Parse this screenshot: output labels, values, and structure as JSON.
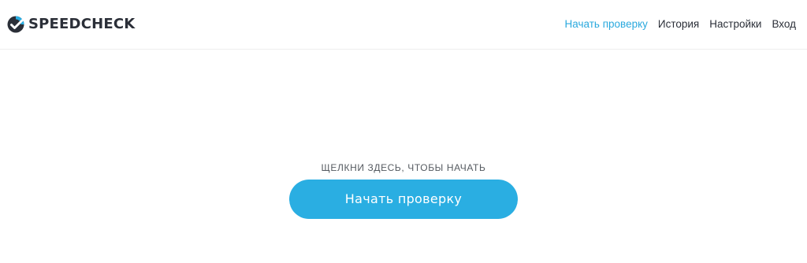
{
  "header": {
    "logo_text": "SPEEDCHECK",
    "nav": [
      {
        "label": "Начать проверку",
        "active": true
      },
      {
        "label": "История",
        "active": false
      },
      {
        "label": "Настройки",
        "active": false
      },
      {
        "label": "Вход",
        "active": false
      }
    ]
  },
  "main": {
    "hint": "ЩЕЛКНИ ЗДЕСЬ, ЧТОБЫ НАЧАТЬ",
    "start_button_label": "Начать проверку"
  },
  "colors": {
    "accent": "#2aaee2",
    "text_dark": "#2b2f38",
    "nav_active": "#2aa9de"
  },
  "icons": {
    "logo": "speedcheck-check-logo-icon"
  }
}
